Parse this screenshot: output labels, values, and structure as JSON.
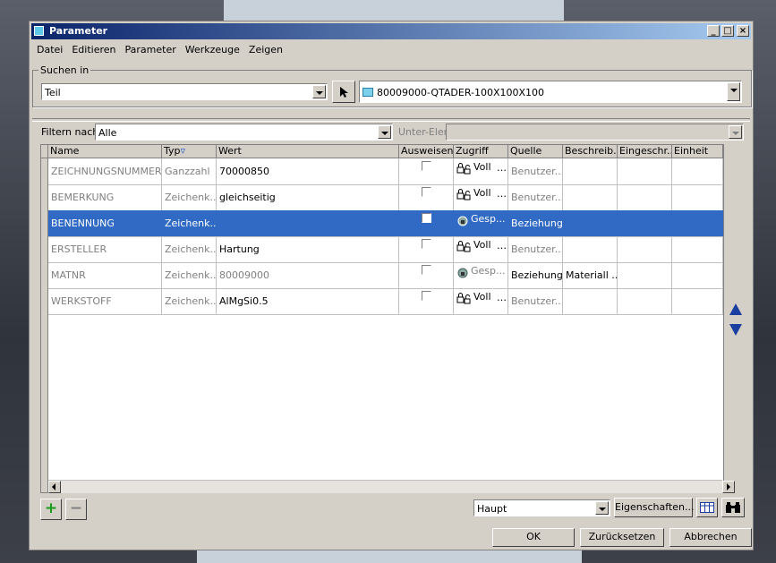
{
  "window": {
    "title": "Parameter"
  },
  "menu": [
    "Datei",
    "Editieren",
    "Parameter",
    "Werkzeuge",
    "Zeigen"
  ],
  "search": {
    "group_label": "Suchen in",
    "scope_value": "Teil",
    "object_value": "80009000-QTADER-100X100X100"
  },
  "filter": {
    "label": "Filtern nach",
    "value": "Alle",
    "sub_label": "Unter-Elem",
    "sub_value": ""
  },
  "table": {
    "columns": [
      "Name",
      "Typ",
      "Wert",
      "Ausweisen",
      "Zugriff",
      "Quelle",
      "Beschreib...",
      "Eingeschr...",
      "Einheit"
    ],
    "rows": [
      {
        "name": "ZEICHNUNGSNUMMER",
        "typ": "Ganzzahl",
        "wert": "70000850",
        "zugriff": "Voll",
        "quelle": "Benutzer...",
        "beschreib": "",
        "selected": false
      },
      {
        "name": "BEMERKUNG",
        "typ": "Zeichenk...",
        "wert": "gleichseitig",
        "zugriff": "Voll",
        "quelle": "Benutzer...",
        "beschreib": "",
        "selected": false
      },
      {
        "name": "BENENNUNG",
        "typ": "Zeichenk...",
        "wert": "",
        "zugriff": "Gesp...",
        "quelle": "Beziehung",
        "beschreib": "",
        "selected": true
      },
      {
        "name": "ERSTELLER",
        "typ": "Zeichenk...",
        "wert": "Hartung",
        "zugriff": "Voll",
        "quelle": "Benutzer...",
        "beschreib": "",
        "selected": false
      },
      {
        "name": "MATNR",
        "typ": "Zeichenk...",
        "wert": "80009000",
        "zugriff": "Gesp...",
        "quelle": "Beziehung",
        "beschreib": "Materiall ...",
        "selected": false
      },
      {
        "name": "WERKSTOFF",
        "typ": "Zeichenk...",
        "wert": "AlMgSi0.5",
        "zugriff": "Voll",
        "quelle": "Benutzer...",
        "beschreib": "",
        "selected": false
      }
    ]
  },
  "bottom": {
    "view_value": "Haupt",
    "properties_label": "Eigenschaften...",
    "ok_label": "OK",
    "reset_label": "Zurücksetzen",
    "cancel_label": "Abbrechen"
  },
  "icons": [
    "window-icon",
    "minimize-icon",
    "maximize-icon",
    "close-icon",
    "pointer-icon",
    "part-icon",
    "filter-icon",
    "lock-icon",
    "add-icon",
    "remove-icon",
    "table-icon",
    "binoculars-icon",
    "scroll-up-icon",
    "scroll-down-icon"
  ]
}
